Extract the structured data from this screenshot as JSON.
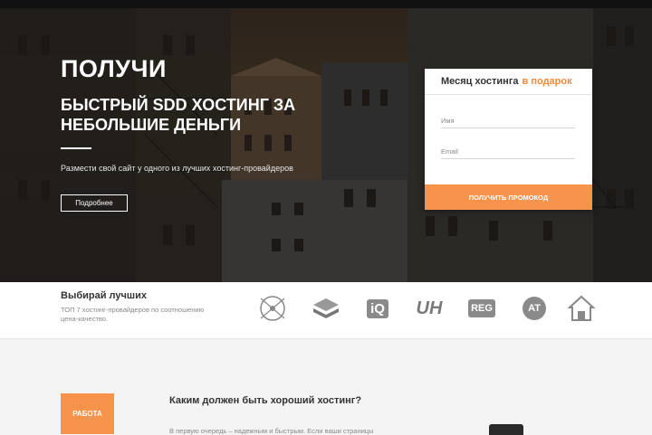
{
  "hero": {
    "title_line1": "ПОЛУЧИ",
    "title_line2": "БЫСТРЫЙ SDD ХОСТИНГ ЗА НЕБОЛЬШИЕ ДЕНЬГИ",
    "subtitle": "Размести свой сайт у одного из лучших хостинг-провайдеров",
    "more_button": "Подробнее"
  },
  "promo_card": {
    "heading": "Месяц хостинга",
    "heading_accent": "в подарок",
    "name_placeholder": "Имя",
    "email_placeholder": "Email",
    "submit_label": "ПОЛУЧИТЬ ПРОМОКОД",
    "accent_color": "#f7934a"
  },
  "partners": {
    "title": "Выбирай лучших",
    "description": "ТОП 7 хостинг-провайдеров по соотношению цена-качество.",
    "logos": [
      {
        "name": "compass-logo-icon"
      },
      {
        "name": "stack-logo-icon"
      },
      {
        "name": "iq",
        "text": "iQ"
      },
      {
        "name": "uh",
        "text": "UH"
      },
      {
        "name": "reg",
        "text": "REG"
      },
      {
        "name": "at",
        "text": "AT"
      },
      {
        "name": "house-logo-icon"
      }
    ]
  },
  "section": {
    "tag": "РАБОТА",
    "question": "Каким должен быть хороший хостинг?",
    "text": "В первую очередь – надежным и быстрым. Если ваши страницы"
  }
}
